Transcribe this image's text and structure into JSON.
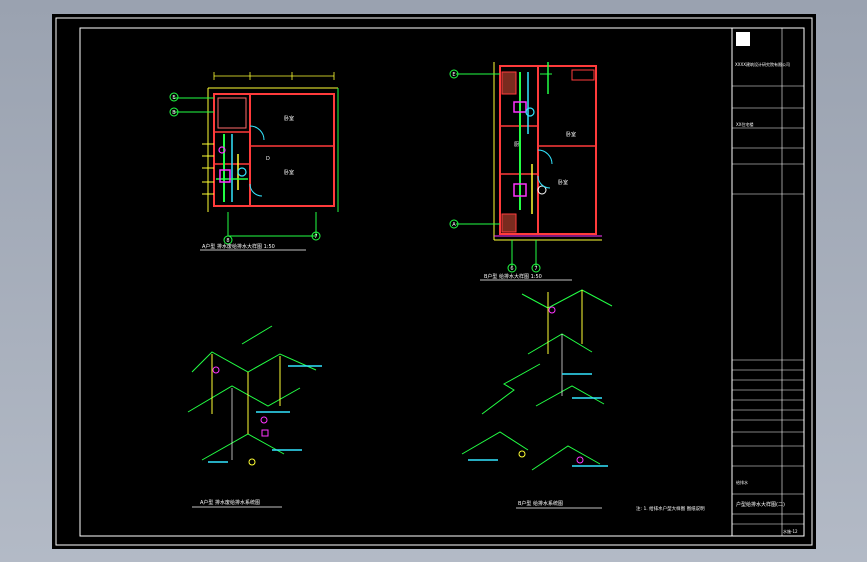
{
  "drawing": {
    "plan_left": {
      "caption": "A户型 排水废给排水大样图 1:50",
      "room_labels": [
        "卧室",
        "卧室",
        "D"
      ],
      "axis_tags": [
        "E",
        "B",
        "8",
        "7"
      ]
    },
    "plan_right": {
      "caption": "B户型 给排水大样图 1:50",
      "room_labels": [
        "卧室",
        "厨",
        "卧室"
      ],
      "axis_tags": [
        "E",
        "A",
        "6",
        "7"
      ]
    },
    "iso_left_caption": "A户型 排水废给排水系统图",
    "iso_right_caption": "B户型 给排水系统图",
    "note_bottom": "注: 1. 给排水户型大样图 图纸说明"
  },
  "title_block": {
    "company": "XXXX建筑设计研究院有限公司",
    "project_name": "XX住宅楼",
    "drawing_title": "户型给排水大样图(二)",
    "sheet_label": "给排水",
    "sheet_no": "水施-12"
  },
  "colors": {
    "sheet_bg": "#000000",
    "wall": "#ff3b3b",
    "pipe_green": "#22ff44",
    "pipe_yellow": "#ffff33",
    "pipe_cyan": "#33e6ff",
    "fixture_magenta": "#ff33ff",
    "text": "#ffffff"
  }
}
